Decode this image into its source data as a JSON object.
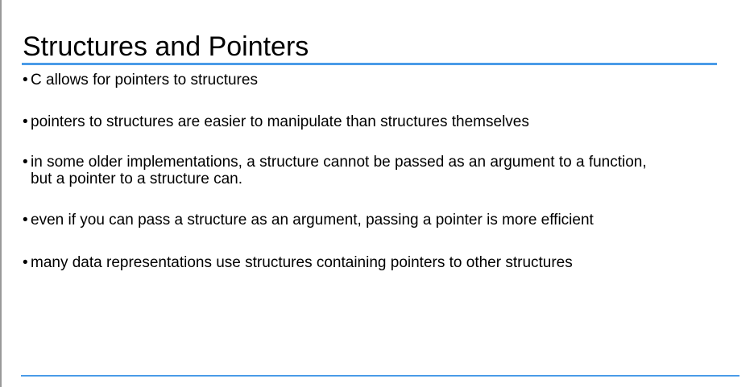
{
  "slide": {
    "title": "Structures and Pointers",
    "bullet_glyph": "•",
    "bullets": [
      {
        "text": "C allows for pointers to structures"
      },
      {
        "text": "pointers to structures are easier to manipulate than structures themselves"
      },
      {
        "line1": "in some older implementations, a structure cannot be passed as an argument to a function,",
        "line2": "but a pointer to a structure can."
      },
      {
        "text": "even if you can pass a structure as an argument, passing a pointer is more efficient"
      },
      {
        "text": "many data representations use structures containing pointers to other structures"
      }
    ]
  },
  "colors": {
    "accent_rule": "#4a9be8",
    "text": "#000000",
    "background": "#ffffff"
  }
}
